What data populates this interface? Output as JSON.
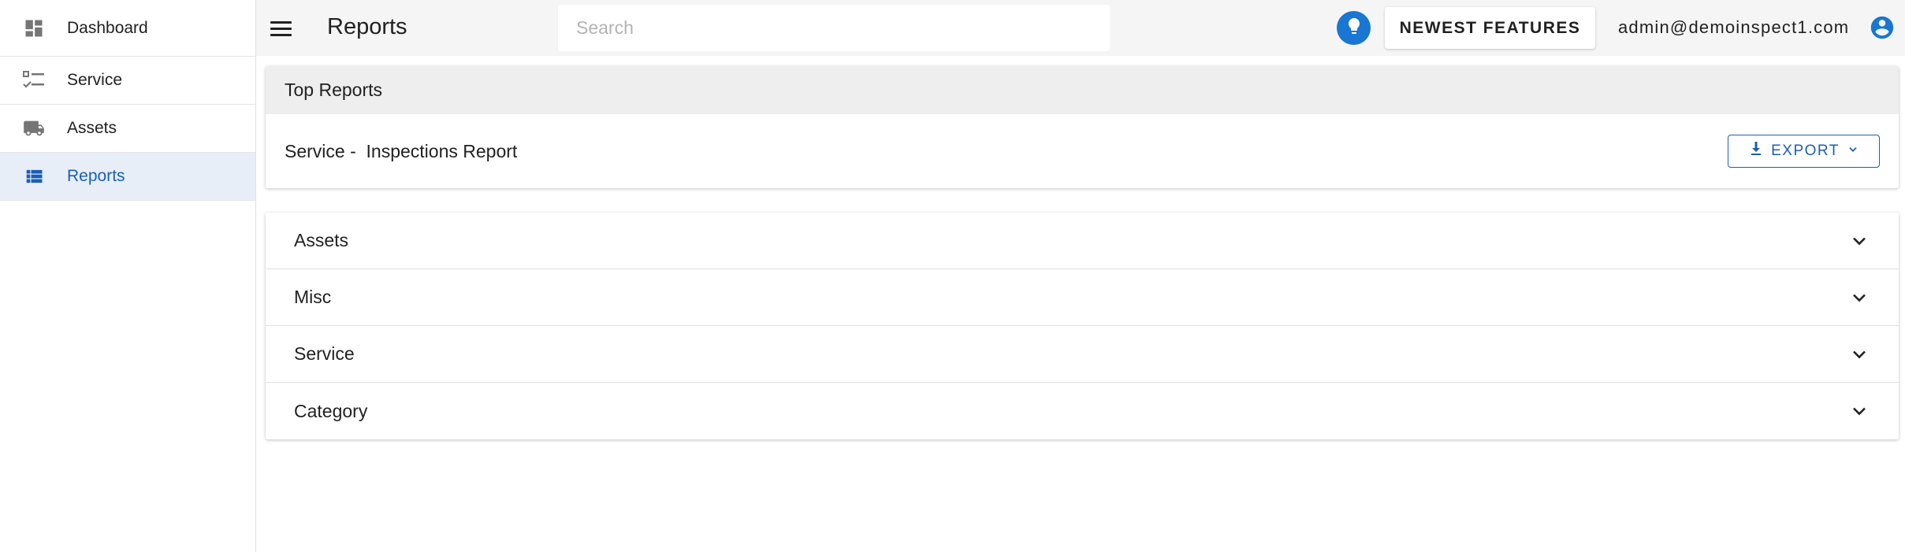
{
  "sidebar": {
    "items": [
      {
        "label": "Dashboard",
        "icon": "dashboard-icon",
        "active": false
      },
      {
        "label": "Service",
        "icon": "checklist-icon",
        "active": false
      },
      {
        "label": "Assets",
        "icon": "truck-icon",
        "active": false
      },
      {
        "label": "Reports",
        "icon": "list-icon",
        "active": true
      }
    ]
  },
  "header": {
    "title": "Reports",
    "search_placeholder": "Search",
    "search_value": "",
    "features_label": "NEWEST FEATURES",
    "user_email": "admin@demoinspect1.com"
  },
  "top_reports": {
    "header": "Top Reports",
    "rows": [
      {
        "name": "Service -  Inspections Report",
        "export_label": "EXPORT"
      }
    ]
  },
  "report_groups": [
    {
      "label": "Assets"
    },
    {
      "label": "Misc"
    },
    {
      "label": "Service"
    },
    {
      "label": "Category"
    }
  ],
  "colors": {
    "accent": "#1a5fb4",
    "active_bg": "#e8eef8",
    "bulb": "#1976d2",
    "topbar_bg": "#f5f5f5",
    "icon_gray": "#757575"
  }
}
